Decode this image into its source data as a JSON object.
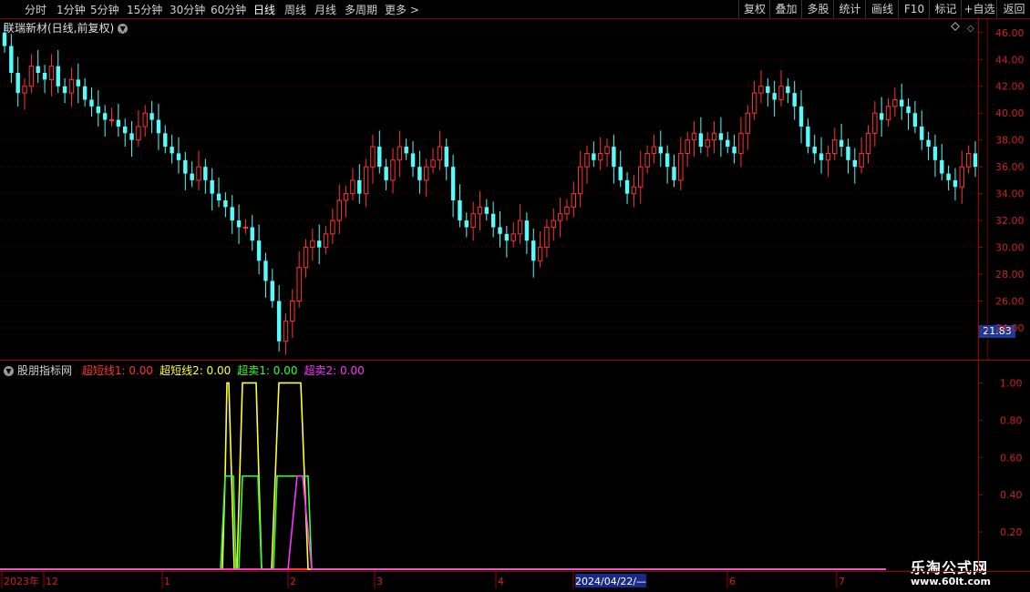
{
  "toolbar": {
    "periods": [
      "分时",
      "1分钟",
      "5分钟",
      "15分钟",
      "30分钟",
      "60分钟",
      "日线",
      "周线",
      "月线",
      "多周期",
      "更多 >"
    ],
    "active_period": "日线",
    "right_buttons": [
      "复权",
      "叠加",
      "多股",
      "统计",
      "画线",
      "F10",
      "标记",
      "+自选",
      "返回"
    ]
  },
  "main_title": "联瑞新材(日线,前复权)",
  "indicator": {
    "name": "股朋指标网",
    "legend": [
      {
        "label": "超短线1: 0.00",
        "color": "#ff3333"
      },
      {
        "label": "超短线2: 0.00",
        "color": "#ffff33"
      },
      {
        "label": "超卖1: 0.00",
        "color": "#33ff33"
      },
      {
        "label": "超卖2: 0.00",
        "color": "#ff33ff"
      }
    ]
  },
  "last_price": "21.83",
  "timeline_labels": [
    "2023年",
    "12",
    "1",
    "2",
    "3",
    "4",
    "2024/04/22/—",
    "6",
    "7"
  ],
  "watermark": {
    "line1": "乐淘公式网",
    "line2": "www.60lt.com"
  },
  "colors": {
    "up": "#ff3232",
    "down": "#54fcfc",
    "grid": "#5a0000",
    "axis": "#a00000"
  },
  "chart_data": [
    {
      "type": "candlestick",
      "title": "联瑞新材(日线,前复权)",
      "ylim": [
        21.83,
        46.8
      ],
      "y_ticks": [
        24,
        26,
        28,
        30,
        32,
        34,
        36,
        38,
        40,
        42,
        44,
        46
      ],
      "close": [
        45,
        43,
        41.5,
        42,
        43.5,
        43,
        42.5,
        43.5,
        42,
        41.5,
        42.5,
        42,
        41,
        40.5,
        40,
        39.5,
        39.5,
        39,
        38.5,
        38,
        39,
        40,
        39.5,
        38.5,
        37.5,
        37,
        36.5,
        35.5,
        35,
        36,
        35,
        34,
        33.5,
        33,
        32,
        31.5,
        31.5,
        30.5,
        29,
        27.5,
        26,
        23,
        24.5,
        26,
        28.5,
        30,
        30.5,
        30,
        31,
        32,
        33.5,
        34,
        35,
        34,
        36,
        37.5,
        36,
        35,
        36.5,
        37.5,
        37,
        36,
        35,
        36,
        36.5,
        37.5,
        36,
        33.5,
        32,
        31.5,
        32.5,
        33,
        32.5,
        31.5,
        31,
        30.5,
        31,
        32,
        30.5,
        29,
        30,
        31.5,
        32,
        32.5,
        33,
        34,
        36,
        37,
        36.5,
        37,
        37.5,
        36,
        35,
        34,
        34.5,
        36,
        37,
        37.5,
        37,
        36,
        35,
        37,
        38,
        38.5,
        37.5,
        38,
        38.5,
        38,
        37.5,
        37,
        38.5,
        40,
        41.5,
        42,
        41.5,
        41,
        42,
        41.5,
        40.5,
        39,
        37.5,
        37,
        36.5,
        37,
        38,
        37.5,
        36.5,
        36,
        37,
        38.5,
        40,
        39.5,
        40.5,
        41,
        40.5,
        40,
        39,
        38,
        37.5,
        36.5,
        35.5,
        35,
        34.5,
        36,
        37,
        36
      ]
    },
    {
      "type": "line",
      "title": "股朋指标网",
      "ylim": [
        0,
        1.1
      ],
      "y_ticks": [
        0.2,
        0.4,
        0.6,
        0.8,
        1.0
      ],
      "series": [
        {
          "name": "超短线1",
          "color": "#ff3333",
          "points": [
            [
              0,
              0
            ],
            [
              972,
              0
            ]
          ]
        },
        {
          "name": "超短线2",
          "color": "#ffff33",
          "points": [
            [
              0,
              0
            ],
            [
              244,
              0
            ],
            [
              247,
              0.5
            ],
            [
              249,
              1
            ],
            [
              251,
              1
            ],
            [
              254,
              0.5
            ],
            [
              257,
              0
            ],
            [
              260,
              0
            ],
            [
              263,
              0.5
            ],
            [
              266,
              1
            ],
            [
              281,
              1
            ],
            [
              284,
              0.5
            ],
            [
              287,
              0
            ],
            [
              298,
              0
            ],
            [
              302,
              0.5
            ],
            [
              306,
              1
            ],
            [
              330,
              1
            ],
            [
              334,
              0.5
            ],
            [
              338,
              0
            ],
            [
              972,
              0
            ]
          ]
        },
        {
          "name": "超卖1",
          "color": "#33ff33",
          "points": [
            [
              0,
              0
            ],
            [
              242,
              0
            ],
            [
              247,
              0.5
            ],
            [
              256,
              0.5
            ],
            [
              259,
              0
            ],
            [
              262,
              0
            ],
            [
              266,
              0.5
            ],
            [
              283,
              0.5
            ],
            [
              287,
              0
            ],
            [
              300,
              0
            ],
            [
              304,
              0.5
            ],
            [
              338,
              0.5
            ],
            [
              342,
              0
            ],
            [
              972,
              0
            ]
          ]
        },
        {
          "name": "超卖2",
          "color": "#ff33ff",
          "points": [
            [
              0,
              0
            ],
            [
              316,
              0
            ],
            [
              322,
              0.3
            ],
            [
              326,
              0.5
            ],
            [
              332,
              0.5
            ],
            [
              338,
              0.2
            ],
            [
              342,
              0
            ],
            [
              972,
              0
            ]
          ]
        }
      ]
    }
  ]
}
